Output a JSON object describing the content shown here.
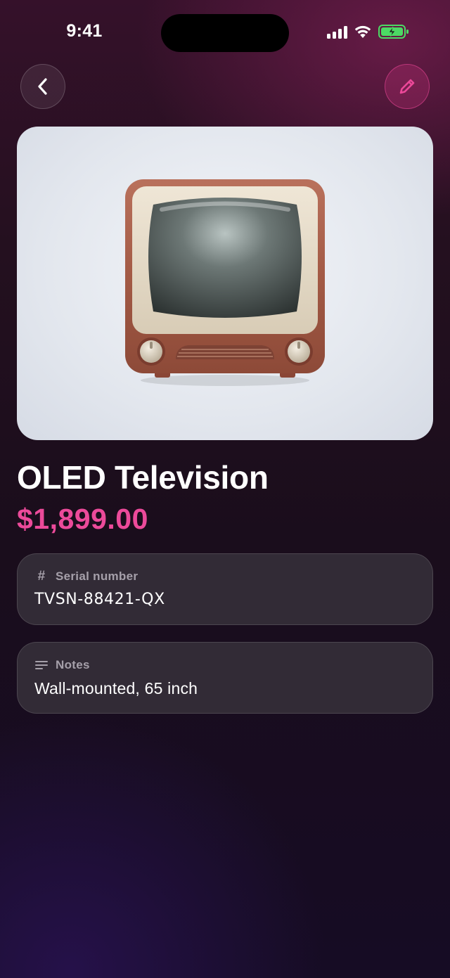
{
  "status_bar": {
    "time": "9:41",
    "icons": [
      "cellular-signal-icon",
      "wifi-icon",
      "battery-charging-icon"
    ],
    "battery_color": "#4cd964"
  },
  "nav": {
    "back_icon": "chevron-left-icon",
    "edit_icon": "pencil-icon",
    "accent_color": "#ec4899"
  },
  "item": {
    "image_icon": "television-icon",
    "name": "OLED Television",
    "price": "$1,899.00",
    "price_color": "#ec4a9a"
  },
  "fields": {
    "serial": {
      "icon": "hash-icon",
      "label": "Serial number",
      "value": "TVSN-88421-QX"
    },
    "notes": {
      "icon": "text-lines-icon",
      "label": "Notes",
      "value": "Wall-mounted, 65 inch"
    }
  }
}
